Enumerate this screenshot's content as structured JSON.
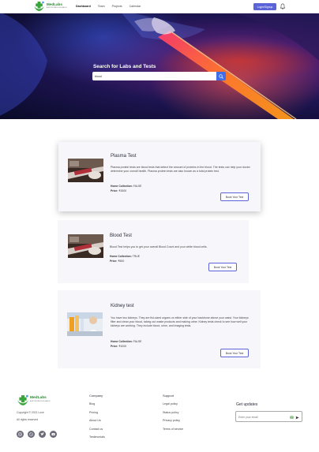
{
  "brand": {
    "name": "MedLabs",
    "tagline": "A BETTER PATH FOR HEALTH"
  },
  "nav": {
    "links": [
      "Dashboard",
      "Team",
      "Projects",
      "Calendar"
    ],
    "active": "Dashboard",
    "login_label": "Login/Signup"
  },
  "hero": {
    "title": "Search for Labs and Tests",
    "search_value": "blood"
  },
  "tests": [
    {
      "title": "Plasma Test",
      "description": "Plasma protein tests are blood tests that detect the amount of proteins in the blood. The tests can help your doctor determine your overall health. Plasma protein tests are also known as a total protein test.",
      "home_collection_label": "Home Collection:",
      "home_collection": "FALSE",
      "price_label": "Price:",
      "price": "₹1500",
      "button": "Book Your Test"
    },
    {
      "title": "Blood Test",
      "description": "Blood Test helps you to get your overall Blood Count and your white blood cells.",
      "home_collection_label": "Home Collection:",
      "home_collection": "TRUE",
      "price_label": "Price:",
      "price": "₹500",
      "button": "Book Your Test"
    },
    {
      "title": "Kidney test",
      "description": "You have two kidneys. They are fist-sized organs on either side of your backbone above your waist. Your kidneys filter and clean your blood, taking out waste products and making urine. Kidney tests check to see how well your kidneys are working. They include blood, urine, and imaging tests.",
      "home_collection_label": "Home Collection:",
      "home_collection": "FALSE",
      "price_label": "Price:",
      "price": "₹1000",
      "button": "Book Your Test"
    }
  ],
  "footer": {
    "copyright": "Copyright © 2021 Love",
    "rights": "All rights reserved",
    "company": {
      "heading": "Company",
      "links": [
        "Blog",
        "Pricing",
        "About Us",
        "Contact us",
        "Testimonials"
      ]
    },
    "support": {
      "heading": "Support",
      "links": [
        "Legal policy",
        "Status policy",
        "Privacy policy",
        "Terms of service"
      ]
    },
    "updates": {
      "heading": "Get updates",
      "placeholder": "Enter your email"
    },
    "socials": [
      "instagram-icon",
      "dribbble-icon",
      "twitter-icon",
      "youtube-icon"
    ]
  },
  "colors": {
    "accent": "#5a63d8",
    "search_button": "#3f6ee8",
    "brand_green": "#2b8a2e"
  }
}
